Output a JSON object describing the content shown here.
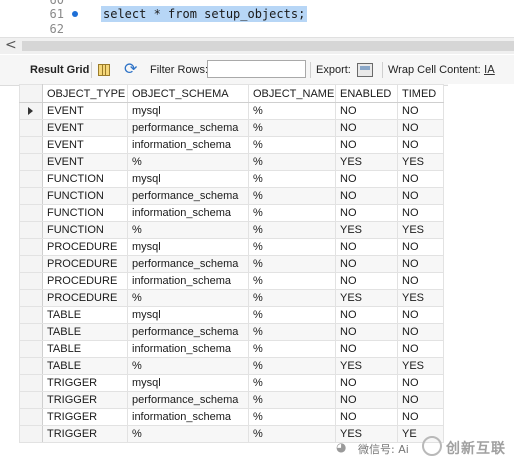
{
  "editor": {
    "lines": [
      {
        "num": "60",
        "text": ""
      },
      {
        "num": "61",
        "text": "select * from setup_objects;"
      },
      {
        "num": "62",
        "text": ""
      }
    ]
  },
  "scrollbar": {
    "left_arrow": "<"
  },
  "toolbar": {
    "result_grid_label": "Result Grid",
    "filter_rows_label": "Filter Rows:",
    "filter_value": "",
    "export_label": "Export:",
    "wrap_label": "Wrap Cell Content:",
    "wrap_icon": "IA"
  },
  "grid": {
    "columns": [
      "OBJECT_TYPE",
      "OBJECT_SCHEMA",
      "OBJECT_NAME",
      "ENABLED",
      "TIMED"
    ],
    "rows": [
      [
        "EVENT",
        "mysql",
        "%",
        "NO",
        "NO"
      ],
      [
        "EVENT",
        "performance_schema",
        "%",
        "NO",
        "NO"
      ],
      [
        "EVENT",
        "information_schema",
        "%",
        "NO",
        "NO"
      ],
      [
        "EVENT",
        "%",
        "%",
        "YES",
        "YES"
      ],
      [
        "FUNCTION",
        "mysql",
        "%",
        "NO",
        "NO"
      ],
      [
        "FUNCTION",
        "performance_schema",
        "%",
        "NO",
        "NO"
      ],
      [
        "FUNCTION",
        "information_schema",
        "%",
        "NO",
        "NO"
      ],
      [
        "FUNCTION",
        "%",
        "%",
        "YES",
        "YES"
      ],
      [
        "PROCEDURE",
        "mysql",
        "%",
        "NO",
        "NO"
      ],
      [
        "PROCEDURE",
        "performance_schema",
        "%",
        "NO",
        "NO"
      ],
      [
        "PROCEDURE",
        "information_schema",
        "%",
        "NO",
        "NO"
      ],
      [
        "PROCEDURE",
        "%",
        "%",
        "YES",
        "YES"
      ],
      [
        "TABLE",
        "mysql",
        "%",
        "NO",
        "NO"
      ],
      [
        "TABLE",
        "performance_schema",
        "%",
        "NO",
        "NO"
      ],
      [
        "TABLE",
        "information_schema",
        "%",
        "NO",
        "NO"
      ],
      [
        "TABLE",
        "%",
        "%",
        "YES",
        "YES"
      ],
      [
        "TRIGGER",
        "mysql",
        "%",
        "NO",
        "NO"
      ],
      [
        "TRIGGER",
        "performance_schema",
        "%",
        "NO",
        "NO"
      ],
      [
        "TRIGGER",
        "information_schema",
        "%",
        "NO",
        "NO"
      ],
      [
        "TRIGGER",
        "%",
        "%",
        "YES",
        "YE"
      ]
    ]
  },
  "watermark": {
    "wechat_text": "微信号: Ai",
    "brand": "创新互联"
  }
}
